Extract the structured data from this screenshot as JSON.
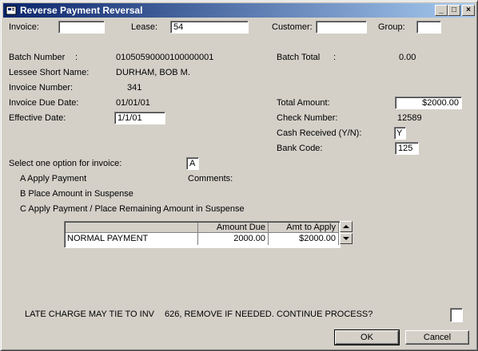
{
  "window": {
    "title": "Reverse Payment Reversal",
    "minimize": "_",
    "maximize": "□",
    "close": "×"
  },
  "search": {
    "invoice_label": "Invoice:",
    "invoice_value": "",
    "lease_label": "Lease:",
    "lease_value": "54",
    "customer_label": "Customer:",
    "customer_value": "",
    "group_label": "Group:",
    "group_value": ""
  },
  "details": {
    "batch_number_label": "Batch Number",
    "batch_number_colon": ":",
    "batch_number": "01050590000100000001",
    "lessee_label": "Lessee Short Name:",
    "lessee_value": "DURHAM, BOB M.",
    "invoice_number_label": "Invoice Number:",
    "invoice_number": "341",
    "invoice_due_label": "Invoice Due Date:",
    "invoice_due": "01/01/01",
    "effective_label": "Effective Date:",
    "effective_value": "1/1/01",
    "batch_total_label": "Batch Total",
    "batch_total_colon": ":",
    "batch_total": "0.00",
    "total_amount_label": "Total Amount:",
    "total_amount": "$2000.00",
    "check_number_label": "Check Number:",
    "check_number": "12589",
    "cash_received_label": "Cash Received (Y/N):",
    "cash_received": "Y",
    "bank_code_label": "Bank Code:",
    "bank_code": "125"
  },
  "options": {
    "prompt": "Select one option for invoice:",
    "value": "A",
    "a": "A Apply Payment",
    "b": "B  Place Amount in Suspense",
    "c": "C  Apply Payment / Place Remaining Amount in Suspense",
    "comments_label": "Comments:"
  },
  "grid": {
    "headers": [
      "",
      "Amount Due",
      "Amt to Apply"
    ],
    "rows": [
      [
        "NORMAL PAYMENT",
        "2000.00",
        "$2000.00"
      ]
    ]
  },
  "message": {
    "part1": "LATE CHARGE MAY TIE TO INV",
    "part2": "626, REMOVE IF NEEDED. CONTINUE PROCESS?",
    "answer": ""
  },
  "buttons": {
    "ok": "OK",
    "cancel": "Cancel"
  }
}
